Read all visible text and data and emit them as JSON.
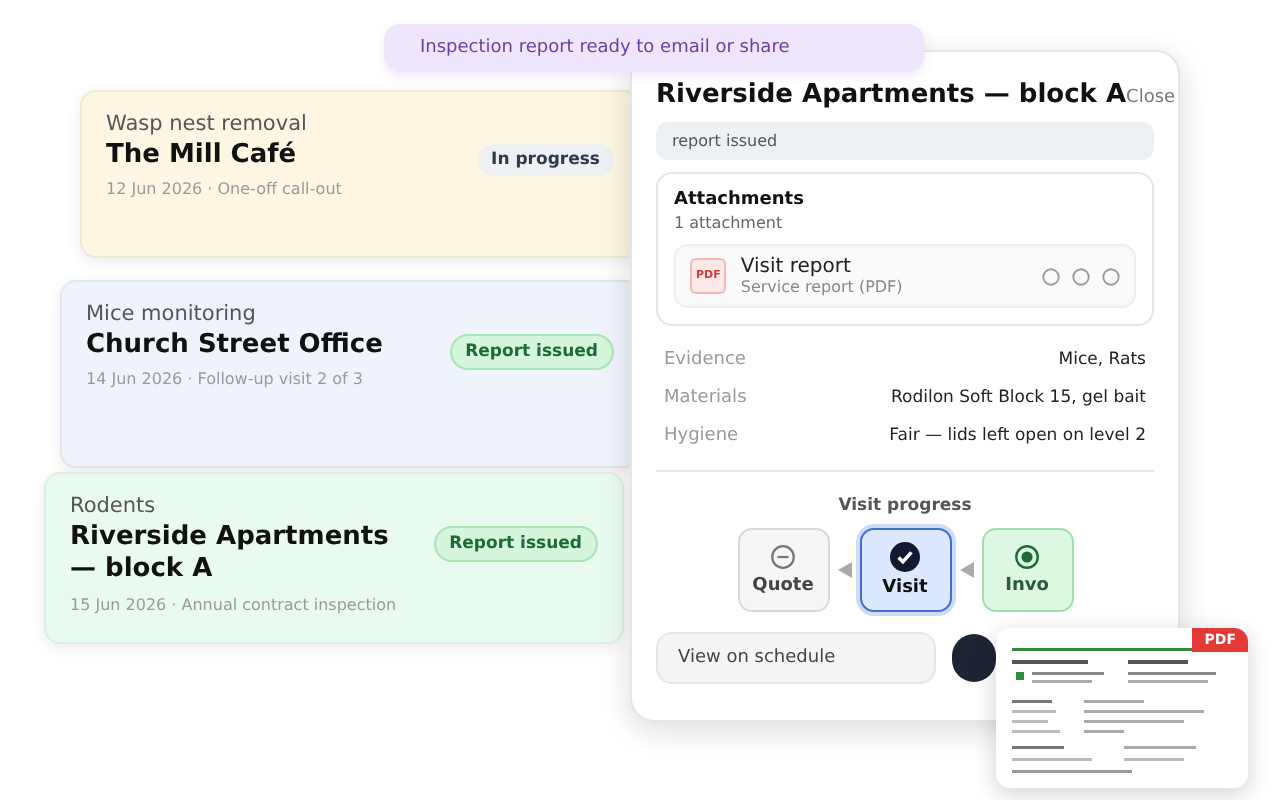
{
  "toast": {
    "text": "Inspection report ready to email or share"
  },
  "jobs": [
    {
      "service": "Wasp nest removal",
      "site": "The Mill Café",
      "meta": "12 Jun 2026 · One-off call-out",
      "status": "In progress",
      "kind": "progress",
      "color": "#fdf6e3"
    },
    {
      "service": "Mice monitoring",
      "site": "Church Street Office",
      "meta": "14 Jun 2026 · Follow-up visit 2 of 3",
      "status": "Report issued",
      "kind": "issued",
      "color": "#eef3fc"
    },
    {
      "service": "Rodents",
      "site": "Riverside Apartments — block A",
      "meta": "15 Jun 2026 · Annual contract inspection",
      "status": "Report issued",
      "kind": "issued",
      "color": "#e9fbef"
    }
  ],
  "detail": {
    "title": "Riverside Apartments — block A",
    "close": "Close",
    "status": "report issued",
    "attachments": {
      "heading": "Attachments",
      "count": "1 attachment",
      "items": [
        {
          "icon": "PDF",
          "name": "Visit report",
          "type": "Service report (PDF)"
        }
      ]
    },
    "fields": [
      {
        "label": "Evidence",
        "value": "Mice, Rats"
      },
      {
        "label": "Materials",
        "value": "Rodilon Soft Block 15, gel bait"
      },
      {
        "label": "Hygiene",
        "value": "Fair — lids left open on level 2"
      }
    ],
    "progress": {
      "heading": "Visit progress",
      "steps": [
        {
          "label": "Quote",
          "kind": "skipped",
          "selected": false
        },
        {
          "label": "Visit",
          "kind": "current",
          "selected": true
        },
        {
          "label": "Invo",
          "kind": "done",
          "selected": false
        }
      ]
    },
    "schedule_button": "View on schedule"
  },
  "pdf_preview": {
    "badge": "PDF"
  }
}
